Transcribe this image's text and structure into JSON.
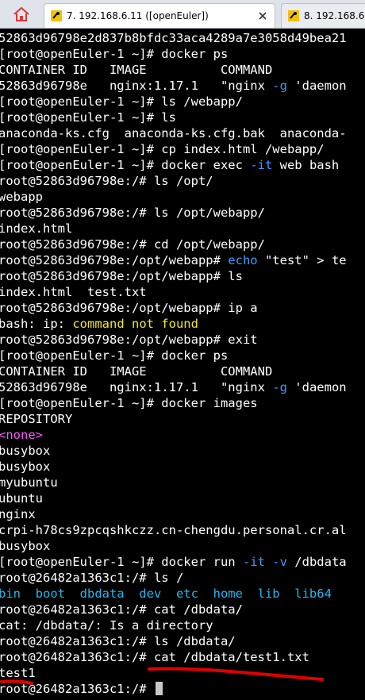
{
  "tabs": [
    {
      "label": "7. 192.168.6.11 ([openEuler])",
      "active": true
    },
    {
      "label": "8. 192.168.6.",
      "active": false
    }
  ],
  "colors": {
    "prompt": "#ffffff",
    "option": "#3b9bff",
    "error": "#f2e92a",
    "none": "#ff55ff",
    "dir": "#22b8f0",
    "annotation": "#e00000"
  },
  "lines": [
    [
      {
        "t": "52863d96798e2d837b8bfdc33aca4289a7e3058d49bea21"
      }
    ],
    [
      {
        "t": "[root@openEuler-1 ~]# docker ps"
      }
    ],
    [
      {
        "t": "CONTAINER ID   IMAGE          COMMAND"
      }
    ],
    [
      {
        "t": "52863d96798e   nginx:1.17.1   \"nginx "
      },
      {
        "t": "-g",
        "c": "blue"
      },
      {
        "t": " 'daemon"
      }
    ],
    [
      {
        "t": "[root@openEuler-1 ~]# ls /webapp/"
      }
    ],
    [
      {
        "t": "[root@openEuler-1 ~]# ls"
      }
    ],
    [
      {
        "t": "anaconda-ks.cfg  anaconda-ks.cfg.bak  anaconda-"
      }
    ],
    [
      {
        "t": "[root@openEuler-1 ~]# cp index.html /webapp/"
      }
    ],
    [
      {
        "t": "[root@openEuler-1 ~]# docker exec "
      },
      {
        "t": "-it",
        "c": "blue"
      },
      {
        "t": " web bash"
      }
    ],
    [
      {
        "t": "root@52863d96798e:/# ls /opt/"
      }
    ],
    [
      {
        "t": "webapp"
      }
    ],
    [
      {
        "t": "root@52863d96798e:/# ls /opt/webapp/"
      }
    ],
    [
      {
        "t": "index.html"
      }
    ],
    [
      {
        "t": "root@52863d96798e:/# cd /opt/webapp/"
      }
    ],
    [
      {
        "t": "root@52863d96798e:/opt/webapp# "
      },
      {
        "t": "echo",
        "c": "blue"
      },
      {
        "t": " \"test\" > te"
      }
    ],
    [
      {
        "t": "root@52863d96798e:/opt/webapp# ls"
      }
    ],
    [
      {
        "t": "index.html  test.txt"
      }
    ],
    [
      {
        "t": "root@52863d96798e:/opt/webapp# ip a"
      }
    ],
    [
      {
        "t": "bash: ip: "
      },
      {
        "t": "command not found",
        "c": "yellow"
      }
    ],
    [
      {
        "t": "root@52863d96798e:/opt/webapp# exit"
      }
    ],
    [
      {
        "t": "[root@openEuler-1 ~]# docker ps"
      }
    ],
    [
      {
        "t": "CONTAINER ID   IMAGE          COMMAND"
      }
    ],
    [
      {
        "t": "52863d96798e   nginx:1.17.1   \"nginx "
      },
      {
        "t": "-g",
        "c": "blue"
      },
      {
        "t": " 'daemon"
      }
    ],
    [
      {
        "t": "[root@openEuler-1 ~]# docker images"
      }
    ],
    [
      {
        "t": "REPOSITORY"
      }
    ],
    [
      {
        "t": "<none>",
        "c": "magenta"
      }
    ],
    [
      {
        "t": "busybox"
      }
    ],
    [
      {
        "t": "busybox"
      }
    ],
    [
      {
        "t": "myubuntu"
      }
    ],
    [
      {
        "t": "ubuntu"
      }
    ],
    [
      {
        "t": "nginx"
      }
    ],
    [
      {
        "t": "crpi-h78cs9zpcqshkczz.cn-chengdu.personal.cr.al"
      }
    ],
    [
      {
        "t": "busybox"
      }
    ],
    [
      {
        "t": "[root@openEuler-1 ~]# docker run "
      },
      {
        "t": "-it -v",
        "c": "blue"
      },
      {
        "t": " /dbdata"
      }
    ],
    [
      {
        "t": "root@26482a1363c1:/# ls /"
      }
    ],
    [
      {
        "t": "bin  boot  dbdata  dev  etc  home  lib  lib64",
        "c": "cyan"
      }
    ],
    [
      {
        "t": "root@26482a1363c1:/# cat /dbdata/"
      }
    ],
    [
      {
        "t": "cat: /dbdata/: Is a directory"
      }
    ],
    [
      {
        "t": "root@26482a1363c1:/# ls /dbdata/"
      }
    ],
    [
      {
        "t": "root@26482a1363c1:/# cat /dbdata/test1.txt"
      }
    ],
    [
      {
        "t": "test1"
      }
    ],
    [
      {
        "t": "root@26482a1363c1:/# "
      }
    ]
  ]
}
